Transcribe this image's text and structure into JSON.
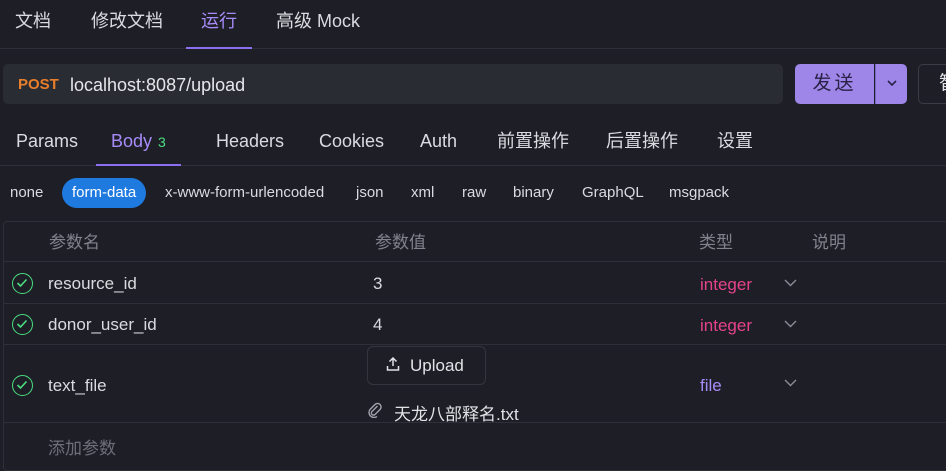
{
  "top_tabs": [
    {
      "label": "文档"
    },
    {
      "label": "修改文档"
    },
    {
      "label": "运行"
    },
    {
      "label": "高级 Mock"
    }
  ],
  "request": {
    "method": "POST",
    "url": "localhost:8087/upload",
    "send_label": "发送",
    "save_label_partial": "智"
  },
  "req_tabs": [
    {
      "label": "Params"
    },
    {
      "label": "Body",
      "badge": "3"
    },
    {
      "label": "Headers"
    },
    {
      "label": "Cookies"
    },
    {
      "label": "Auth"
    },
    {
      "label": "前置操作"
    },
    {
      "label": "后置操作"
    },
    {
      "label": "设置"
    }
  ],
  "body_types": [
    "none",
    "form-data",
    "x-www-form-urlencoded",
    "json",
    "xml",
    "raw",
    "binary",
    "GraphQL",
    "msgpack"
  ],
  "selected_body_type": "form-data",
  "table": {
    "headers": {
      "name": "参数名",
      "value": "参数值",
      "type": "类型",
      "desc": "说明"
    },
    "rows": [
      {
        "name": "resource_id",
        "value": "3",
        "type": "integer",
        "checked": true
      },
      {
        "name": "donor_user_id",
        "value": "4",
        "type": "integer",
        "checked": true
      },
      {
        "name": "text_file",
        "upload_label": "Upload",
        "file_name": "天龙八部释名.txt",
        "type": "file",
        "checked": true
      }
    ],
    "add_placeholder": "添加参数"
  },
  "colors": {
    "accent": "#a78bfa",
    "send_button": "#9d86e8",
    "method_post": "#e87e2a",
    "check_green": "#4ade80",
    "type_integer": "#e6428c",
    "selected_pill": "#1f7ae0"
  },
  "icons": [
    "chevron-down-icon",
    "check-circle-icon",
    "upload-icon",
    "paperclip-icon"
  ]
}
